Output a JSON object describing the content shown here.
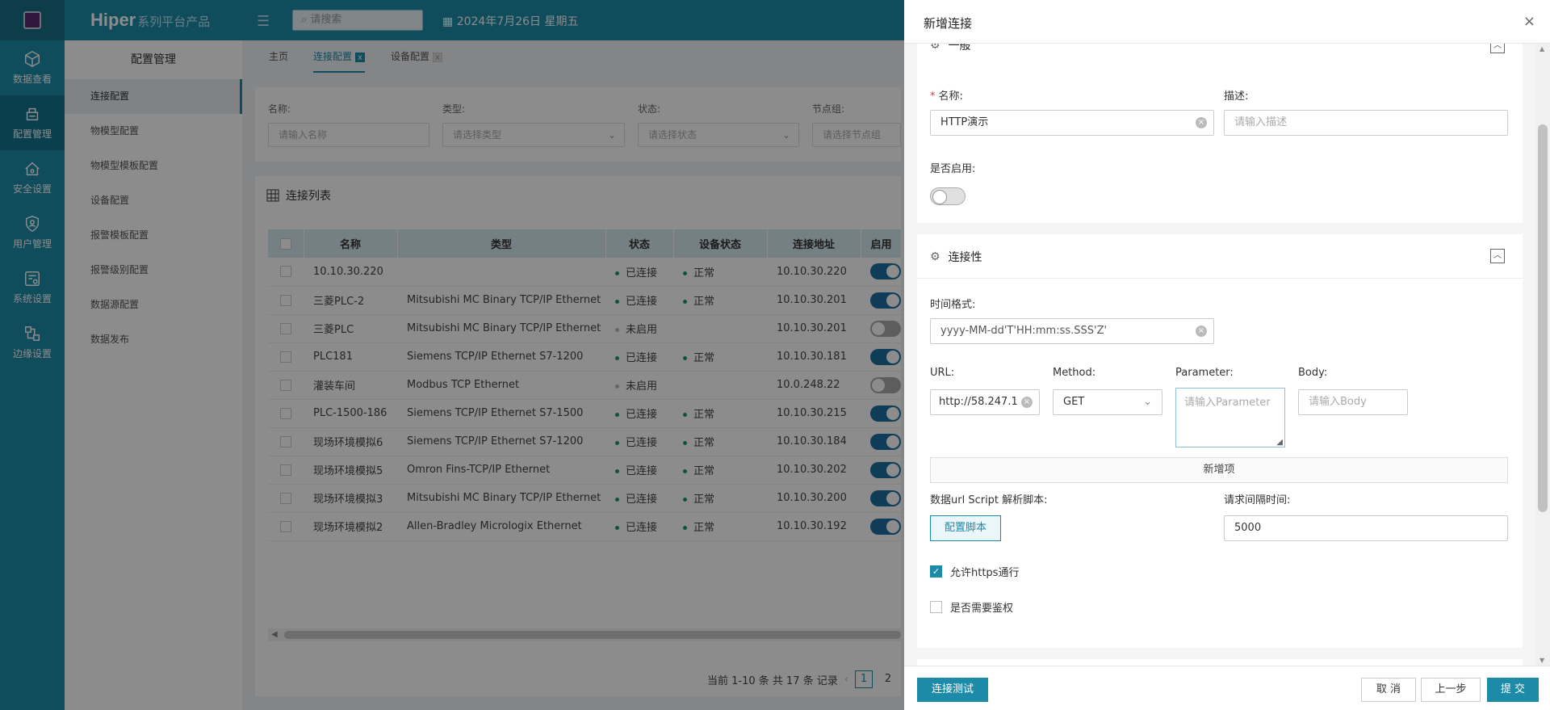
{
  "rail": {
    "items": [
      {
        "label": "数据查看",
        "icon": "cube-icon"
      },
      {
        "label": "配置管理",
        "icon": "config-icon"
      },
      {
        "label": "安全设置",
        "icon": "home-shield-icon"
      },
      {
        "label": "用户管理",
        "icon": "user-shield-icon"
      },
      {
        "label": "系统设置",
        "icon": "system-settings-icon"
      },
      {
        "label": "边缘设置",
        "icon": "edge-nodes-icon"
      }
    ]
  },
  "header": {
    "brand_main": "Hiper",
    "brand_sub": "系列平台产品",
    "search_placeholder": "请搜索",
    "date": "2024年7月26日 星期五"
  },
  "sidebar": {
    "title": "配置管理",
    "items": [
      "连接配置",
      "物模型配置",
      "物模型模板配置",
      "设备配置",
      "报警模板配置",
      "报警级别配置",
      "数据源配置",
      "数据发布"
    ]
  },
  "tabs": [
    {
      "label": "主页"
    },
    {
      "label": "连接配置",
      "closable": "x"
    },
    {
      "label": "设备配置",
      "closable": "x"
    }
  ],
  "filters": {
    "name_label": "名称:",
    "name_placeholder": "请输入名称",
    "type_label": "类型:",
    "type_placeholder": "请选择类型",
    "status_label": "状态:",
    "status_placeholder": "请选择状态",
    "node_label": "节点组:",
    "node_placeholder": "请选择节点组"
  },
  "table": {
    "title": "连接列表",
    "columns": [
      "名称",
      "类型",
      "状态",
      "设备状态",
      "连接地址",
      "启用"
    ],
    "rows": [
      {
        "name": "10.10.30.220",
        "type": "",
        "status": "已连接",
        "device_status": "正常",
        "address": "10.10.30.220",
        "enabled": true
      },
      {
        "name": "三菱PLC-2",
        "type": "Mitsubishi MC Binary TCP/IP Ethernet",
        "status": "已连接",
        "device_status": "正常",
        "address": "10.10.30.201",
        "enabled": true
      },
      {
        "name": "三菱PLC",
        "type": "Mitsubishi MC Binary TCP/IP Ethernet",
        "status": "未启用",
        "device_status": "",
        "address": "10.10.30.201",
        "enabled": false
      },
      {
        "name": "PLC181",
        "type": "Siemens TCP/IP Ethernet S7-1200",
        "status": "已连接",
        "device_status": "正常",
        "address": "10.10.30.181",
        "enabled": true
      },
      {
        "name": "灌装车间",
        "type": "Modbus TCP Ethernet",
        "status": "未启用",
        "device_status": "",
        "address": "10.0.248.22",
        "enabled": false
      },
      {
        "name": "PLC-1500-186",
        "type": "Siemens TCP/IP Ethernet S7-1500",
        "status": "已连接",
        "device_status": "正常",
        "address": "10.10.30.215",
        "enabled": true
      },
      {
        "name": "现场环境模拟6",
        "type": "Siemens TCP/IP Ethernet S7-1200",
        "status": "已连接",
        "device_status": "正常",
        "address": "10.10.30.184",
        "enabled": true
      },
      {
        "name": "现场环境模拟5",
        "type": "Omron Fins-TCP/IP Ethernet",
        "status": "已连接",
        "device_status": "正常",
        "address": "10.10.30.202",
        "enabled": true
      },
      {
        "name": "现场环境模拟3",
        "type": "Mitsubishi MC Binary TCP/IP Ethernet",
        "status": "已连接",
        "device_status": "正常",
        "address": "10.10.30.200",
        "enabled": true
      },
      {
        "name": "现场环境模拟2",
        "type": "Allen-Bradley Micrologix Ethernet",
        "status": "已连接",
        "device_status": "正常",
        "address": "10.10.30.192",
        "enabled": true
      }
    ],
    "pager_text": "当前 1-10 条 共 17 条 记录",
    "pages": [
      "1",
      "2"
    ],
    "prev_arrow": "‹"
  },
  "drawer": {
    "title": "新增连接",
    "close_glyph": "×",
    "general": {
      "title": "一般",
      "name_label": "名称:",
      "name_value": "HTTP演示",
      "desc_label": "描述:",
      "desc_placeholder": "请输入描述",
      "enabled_label": "是否启用:"
    },
    "connectivity": {
      "title": "连接性",
      "time_format_label": "时间格式:",
      "time_format_value": "yyyy-MM-dd'T'HH:mm:ss.SSS'Z'",
      "url_label": "URL:",
      "url_value": "http://58.247.1",
      "method_label": "Method:",
      "method_value": "GET",
      "parameter_label": "Parameter:",
      "parameter_placeholder": "请输入Parameter",
      "body_label": "Body:",
      "body_placeholder": "请输入Body",
      "add_item": "新增项",
      "script_label": "数据url Script 解析脚本:",
      "script_button": "配置脚本",
      "interval_label": "请求间隔时间:",
      "interval_value": "5000",
      "allow_https": "允许https通行",
      "need_auth": "是否需要鉴权"
    },
    "footer": {
      "test": "连接测试",
      "cancel": "取 消",
      "prev": "上一步",
      "submit": "提 交"
    }
  }
}
